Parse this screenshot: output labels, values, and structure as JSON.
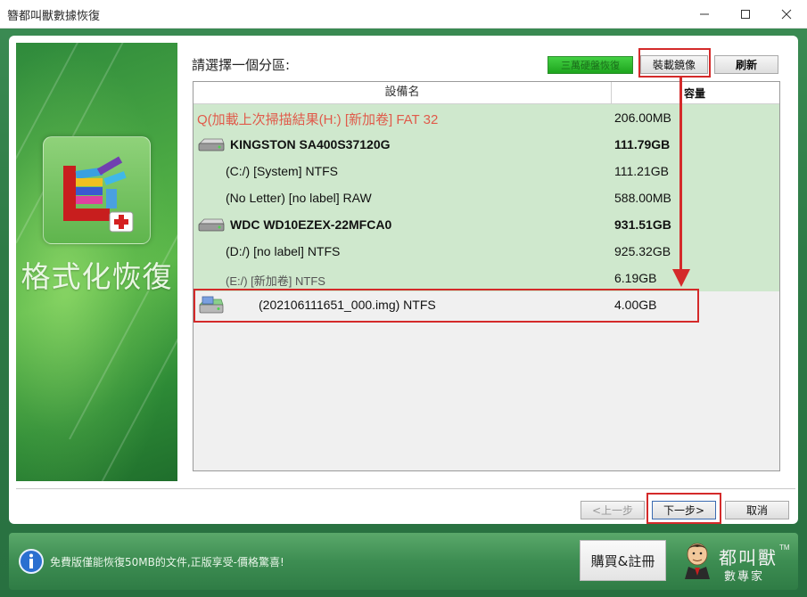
{
  "window": {
    "title": "簪都叫獸數據恢復",
    "minimize_label": "—",
    "maximize_label": "☐",
    "close_label": "✕"
  },
  "banner": {
    "text": "格式化恢復",
    "icon": "defrag-blocks-icon"
  },
  "header": {
    "prompt": "請選擇一個分區:",
    "green_button_label": "三萬硬盤恢復",
    "mount_image_label": "裝載鏡像",
    "refresh_label": "刷新"
  },
  "table": {
    "columns": [
      "設備名",
      "容量"
    ],
    "rows": [
      {
        "name": "Q(加載上次掃描結果(H:) [新加卷] FAT 32",
        "size": "206.00MB",
        "style": "red",
        "icon": ""
      },
      {
        "name": "KINGSTON SA400S37120G",
        "size": "111.79GB",
        "style": "bold",
        "icon": "hard-disk-icon"
      },
      {
        "name": "(C:/) [System] NTFS",
        "size": "111.21GB",
        "style": "normal",
        "icon": ""
      },
      {
        "name": "(No Letter) [no label] RAW",
        "size": "588.00MB",
        "style": "normal",
        "icon": ""
      },
      {
        "name": "WDC WD10EZEX-22MFCA0",
        "size": "931.51GB",
        "style": "bold",
        "icon": "hard-disk-icon"
      },
      {
        "name": "(D:/) [no label] NTFS",
        "size": "925.32GB",
        "style": "normal",
        "icon": ""
      },
      {
        "name": "(E:/) [新加卷] NTFS",
        "size": "6.19GB",
        "style": "dim",
        "icon": ""
      },
      {
        "name": "(202106111651_000.img) NTFS",
        "size": "4.00GB",
        "style": "selected",
        "icon": "disk-image-icon"
      }
    ]
  },
  "nav": {
    "prev_label": "<上一步",
    "next_label": "下一步>",
    "cancel_label": "取消"
  },
  "footer": {
    "notice": "免費版僅能恢復50MB的文件,正版享受-價格驚喜!",
    "buy_label": "購買&註冊",
    "logo_name": "都叫獸",
    "logo_tm": "TM",
    "logo_sub": "數專家"
  },
  "colors": {
    "frame_green": "#2e7a46",
    "row_highlight": "#cfe8cd",
    "annotation_red": "#d42a2a",
    "scan_result_text": "#e05a4a"
  }
}
